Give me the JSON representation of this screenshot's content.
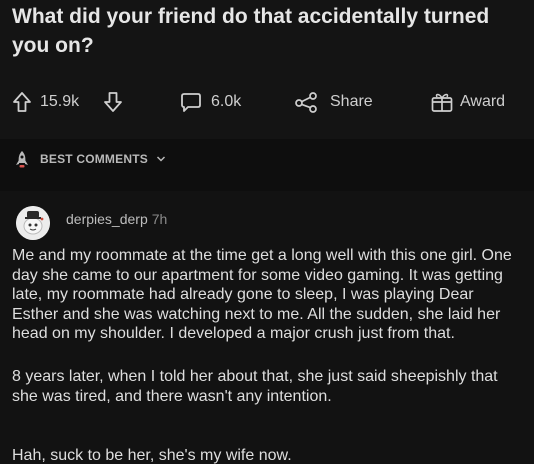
{
  "post": {
    "title": "What did your friend do that accidentally turned you on?"
  },
  "actions": {
    "upvotes": "15.9k",
    "comments": "6.0k",
    "share_label": "Share",
    "award_label": "Award"
  },
  "sort": {
    "label": "BEST COMMENTS"
  },
  "comment": {
    "author": "derpies_derp",
    "time": "7h",
    "paragraphs": [
      "Me and my roommate at the time get a long well with this one girl. One day she came to our apartment for some video gaming. It was getting late, my roommate had already gone to sleep, I was playing Dear Esther and she was watching next to me. All the sudden, she laid her head on my shoulder. I developed a major crush just from that.",
      "8 years later, when I told her about that, she just said sheepishly that she was tired, and there wasn't any intention.",
      "Hah, suck to be her, she's my wife now."
    ]
  }
}
